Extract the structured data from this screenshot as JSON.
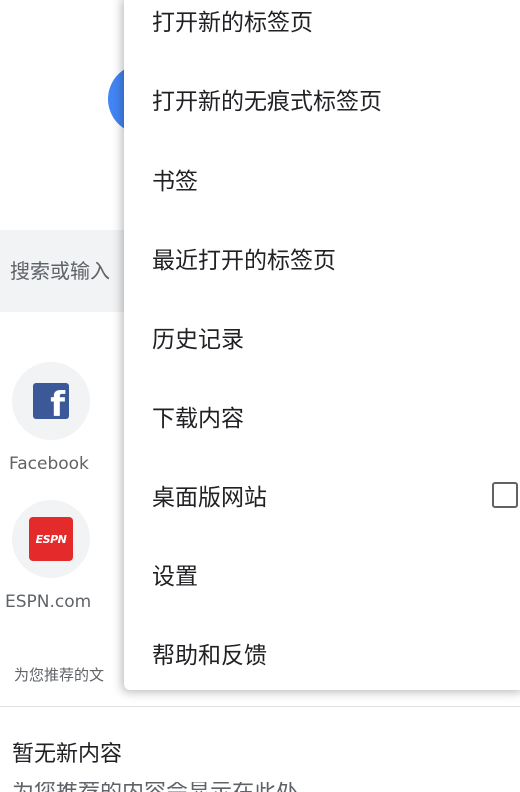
{
  "search": {
    "placeholder": "搜索或输入"
  },
  "tiles": [
    {
      "label": "Facebook",
      "icon": "facebook-icon",
      "icon_text": "f",
      "color": "#3b5998"
    },
    {
      "label": "ESPN.com",
      "icon": "espn-icon",
      "icon_text": "ESPN",
      "color": "#e42a2a"
    }
  ],
  "feed": {
    "recommend_label": "为您推荐的文",
    "no_content_title": "暂无新内容",
    "cutoff_text": "为您推荐的内容会显示在此处"
  },
  "menu": {
    "items": [
      {
        "label": "打开新的标签页"
      },
      {
        "label": "打开新的无痕式标签页"
      },
      {
        "label": "书签"
      },
      {
        "label": "最近打开的标签页"
      },
      {
        "label": "历史记录"
      },
      {
        "label": "下载内容"
      },
      {
        "label": "桌面版网站",
        "checkbox": true,
        "checked": false
      },
      {
        "label": "设置"
      },
      {
        "label": "帮助和反馈"
      }
    ]
  },
  "colors": {
    "accent_blue": "#4285f4",
    "surface_gray": "#f1f3f4",
    "text_primary": "#202124",
    "text_secondary": "#5f6368"
  }
}
